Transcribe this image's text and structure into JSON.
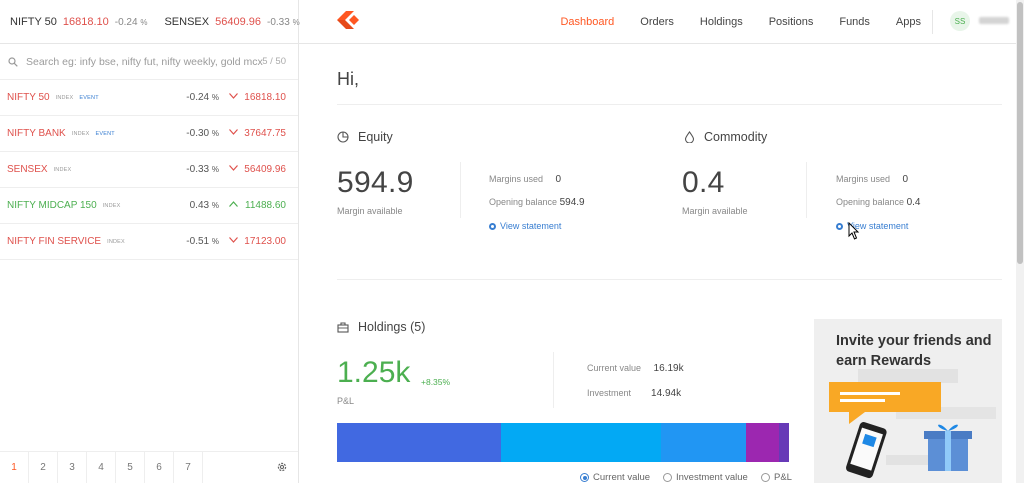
{
  "header": {
    "tickers": [
      {
        "name": "NIFTY 50",
        "price": "16818.10",
        "change": "-0.24",
        "unit": "%"
      },
      {
        "name": "SENSEX",
        "price": "56409.96",
        "change": "-0.33",
        "unit": "%"
      }
    ],
    "nav": [
      "Dashboard",
      "Orders",
      "Holdings",
      "Positions",
      "Funds",
      "Apps"
    ],
    "active_nav": "Dashboard",
    "avatar_initials": "SS",
    "accent_color": "#ff5722"
  },
  "sidebar": {
    "search": {
      "placeholder": "Search eg: infy bse, nifty fut, nifty weekly, gold mcx",
      "count": "5 / 50"
    },
    "watchlist": [
      {
        "symbol": "NIFTY 50",
        "tags": [
          "INDEX",
          "EVENT"
        ],
        "change": "-0.24",
        "unit": "%",
        "ltp": "16818.10",
        "direction": "down"
      },
      {
        "symbol": "NIFTY BANK",
        "tags": [
          "INDEX",
          "EVENT"
        ],
        "change": "-0.30",
        "unit": "%",
        "ltp": "37647.75",
        "direction": "down"
      },
      {
        "symbol": "SENSEX",
        "tags": [
          "INDEX"
        ],
        "change": "-0.33",
        "unit": "%",
        "ltp": "56409.96",
        "direction": "down"
      },
      {
        "symbol": "NIFTY MIDCAP 150",
        "tags": [
          "INDEX"
        ],
        "change": "0.43",
        "unit": "%",
        "ltp": "11488.60",
        "direction": "up"
      },
      {
        "symbol": "NIFTY FIN SERVICE",
        "tags": [
          "INDEX"
        ],
        "change": "-0.51",
        "unit": "%",
        "ltp": "17123.00",
        "direction": "down"
      }
    ],
    "pages": [
      "1",
      "2",
      "3",
      "4",
      "5",
      "6",
      "7"
    ],
    "active_page": "1"
  },
  "main": {
    "greeting": "Hi,",
    "equity": {
      "title": "Equity",
      "margin_available": "594.9",
      "margin_available_label": "Margin available",
      "margins_used_label": "Margins used",
      "margins_used": "0",
      "opening_balance_label": "Opening balance",
      "opening_balance": "594.9",
      "view_statement": "View statement"
    },
    "commodity": {
      "title": "Commodity",
      "margin_available": "0.4",
      "margin_available_label": "Margin available",
      "margins_used_label": "Margins used",
      "margins_used": "0",
      "opening_balance_label": "Opening balance",
      "opening_balance": "0.4",
      "view_statement": "View statement"
    },
    "holdings": {
      "title": "Holdings (5)",
      "pnl": "1.25k",
      "pnl_pct": "+8.35%",
      "pnl_label": "P&L",
      "current_value_label": "Current value",
      "current_value": "16.19k",
      "investment_label": "Investment",
      "investment": "14.94k",
      "allocation_colors": [
        "#4169e1",
        "#03a9f4",
        "#2196f3",
        "#9c27b0",
        "#673ab7"
      ],
      "legend": [
        "Current value",
        "Investment value",
        "P&L"
      ],
      "legend_selected": "Current value"
    },
    "promo": {
      "title": "Invite your friends and earn Rewards"
    }
  }
}
